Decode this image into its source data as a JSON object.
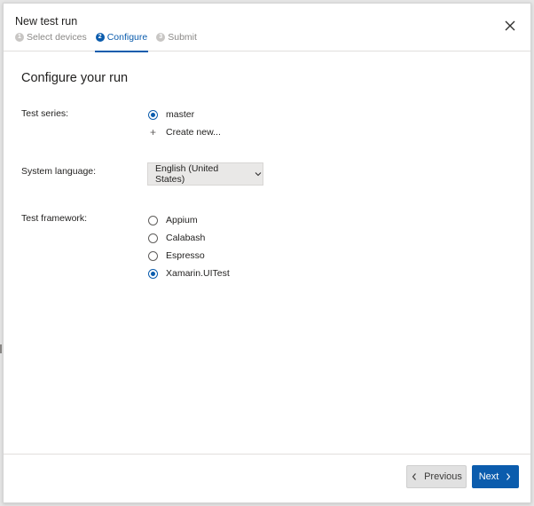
{
  "dialog": {
    "title": "New test run",
    "steps": [
      {
        "num": "1",
        "label": "Select devices",
        "active": false
      },
      {
        "num": "2",
        "label": "Configure",
        "active": true
      },
      {
        "num": "3",
        "label": "Submit",
        "active": false
      }
    ],
    "close_icon": "close-icon"
  },
  "form": {
    "section_title": "Configure your run",
    "test_series": {
      "label": "Test series:",
      "options": [
        {
          "label": "master",
          "checked": true
        }
      ],
      "create_new_label": "Create new..."
    },
    "system_language": {
      "label": "System language:",
      "selected": "English (United States)"
    },
    "test_framework": {
      "label": "Test framework:",
      "options": [
        {
          "label": "Appium",
          "checked": false
        },
        {
          "label": "Calabash",
          "checked": false
        },
        {
          "label": "Espresso",
          "checked": false
        },
        {
          "label": "Xamarin.UITest",
          "checked": true
        }
      ]
    }
  },
  "footer": {
    "previous_label": "Previous",
    "next_label": "Next"
  },
  "colors": {
    "accent": "#0b5cad",
    "secondary_button": "#e1e1e1"
  }
}
